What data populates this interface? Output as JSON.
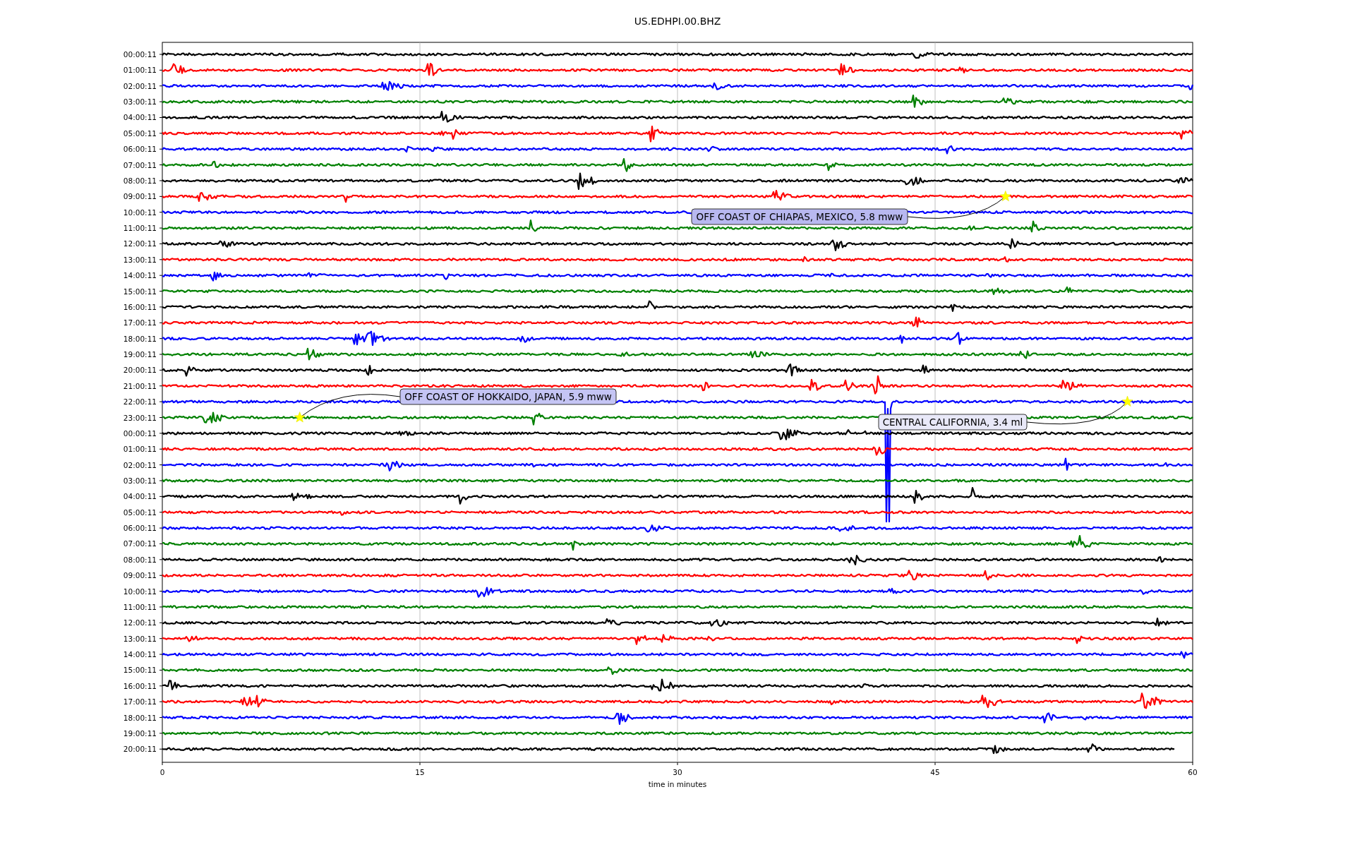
{
  "title": "US.EDHPI.00.BHZ",
  "rows": [
    {
      "label": "00:00:11",
      "color": "#000000"
    },
    {
      "label": "01:00:11",
      "color": "#ff0000"
    },
    {
      "label": "02:00:11",
      "color": "#0000ff"
    },
    {
      "label": "03:00:11",
      "color": "#008000"
    },
    {
      "label": "04:00:11",
      "color": "#000000"
    },
    {
      "label": "05:00:11",
      "color": "#ff0000"
    },
    {
      "label": "06:00:11",
      "color": "#0000ff"
    },
    {
      "label": "07:00:11",
      "color": "#008000"
    },
    {
      "label": "08:00:11",
      "color": "#000000"
    },
    {
      "label": "09:00:11",
      "color": "#ff0000"
    },
    {
      "label": "10:00:11",
      "color": "#0000ff"
    },
    {
      "label": "11:00:11",
      "color": "#008000"
    },
    {
      "label": "12:00:11",
      "color": "#000000"
    },
    {
      "label": "13:00:11",
      "color": "#ff0000"
    },
    {
      "label": "14:00:11",
      "color": "#0000ff"
    },
    {
      "label": "15:00:11",
      "color": "#008000"
    },
    {
      "label": "16:00:11",
      "color": "#000000"
    },
    {
      "label": "17:00:11",
      "color": "#ff0000"
    },
    {
      "label": "18:00:11",
      "color": "#0000ff"
    },
    {
      "label": "19:00:11",
      "color": "#008000"
    },
    {
      "label": "20:00:11",
      "color": "#000000"
    },
    {
      "label": "21:00:11",
      "color": "#ff0000"
    },
    {
      "label": "22:00:11",
      "color": "#0000ff"
    },
    {
      "label": "23:00:11",
      "color": "#008000"
    },
    {
      "label": "00:00:11",
      "color": "#000000"
    },
    {
      "label": "01:00:11",
      "color": "#ff0000"
    },
    {
      "label": "02:00:11",
      "color": "#0000ff"
    },
    {
      "label": "03:00:11",
      "color": "#008000"
    },
    {
      "label": "04:00:11",
      "color": "#000000"
    },
    {
      "label": "05:00:11",
      "color": "#ff0000"
    },
    {
      "label": "06:00:11",
      "color": "#0000ff"
    },
    {
      "label": "07:00:11",
      "color": "#008000"
    },
    {
      "label": "08:00:11",
      "color": "#000000"
    },
    {
      "label": "09:00:11",
      "color": "#ff0000"
    },
    {
      "label": "10:00:11",
      "color": "#0000ff"
    },
    {
      "label": "11:00:11",
      "color": "#008000"
    },
    {
      "label": "12:00:11",
      "color": "#000000"
    },
    {
      "label": "13:00:11",
      "color": "#ff0000"
    },
    {
      "label": "14:00:11",
      "color": "#0000ff"
    },
    {
      "label": "15:00:11",
      "color": "#008000"
    },
    {
      "label": "16:00:11",
      "color": "#000000"
    },
    {
      "label": "17:00:11",
      "color": "#ff0000"
    },
    {
      "label": "18:00:11",
      "color": "#0000ff"
    },
    {
      "label": "19:00:11",
      "color": "#008000"
    },
    {
      "label": "20:00:11",
      "color": "#000000"
    }
  ],
  "x_ticks": [
    "0",
    "15",
    "30",
    "45",
    "60"
  ],
  "xlabel": "time in minutes",
  "annotations": [
    {
      "text": "OFF COAST OF CHIAPAS, MEXICO, 5.8 mww"
    },
    {
      "text": "OFF COAST OF HOKKAIDO, JAPAN, 5.9 mww"
    },
    {
      "text": "CENTRAL CALIFORNIA, 3.4 ml"
    }
  ]
}
